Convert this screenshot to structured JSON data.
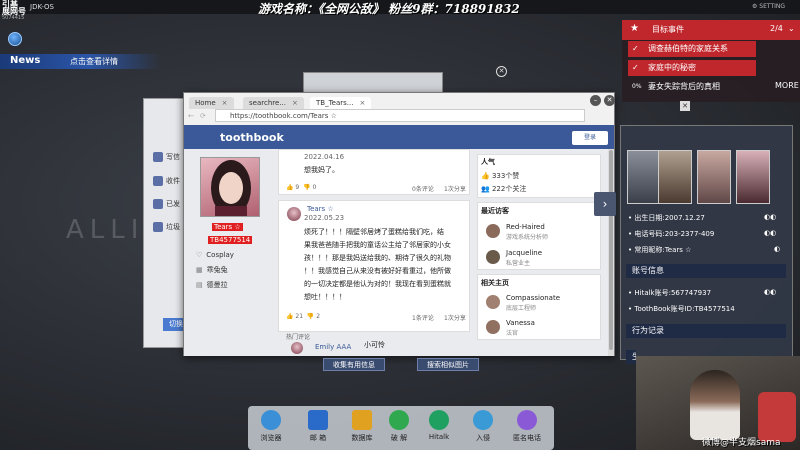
{
  "topbar": {
    "logo": "引基\n展网号",
    "os_name": "JDK-OS",
    "sub": "5074415",
    "title": "游戏名称：《全网公敌》 粉丝9群：718891832",
    "setting": "SETTING"
  },
  "news": {
    "label": "News",
    "link": "点击查看详情"
  },
  "ghost": "ALLI",
  "back_window": {
    "items": [
      "写信",
      "收件",
      "已发",
      "垃圾"
    ],
    "button": "切换"
  },
  "browser": {
    "tabs": [
      {
        "label": "Home"
      },
      {
        "label": "searchre..."
      },
      {
        "label": "TB_Tears..."
      }
    ],
    "url": "https://toothbook.com/Tears ☆",
    "brand": "toothbook",
    "login": "登录",
    "profile": {
      "name": "Tears ☆",
      "id": "TB4577514",
      "info": [
        "Cosplay",
        "乖兔兔",
        "德曼拉"
      ]
    },
    "posts": [
      {
        "date": "2022.04.16",
        "text": "想我妈了。",
        "likes": "9",
        "dislikes": "0",
        "comments": "0条评论",
        "shares": "1次分享"
      },
      {
        "name": "Tears ☆",
        "date": "2022.05.23",
        "text": [
          "烦死了！！！隔壁邻居烤了蛋糕给我们吃，结",
          "果我爸爸随手把我的童话公主给了邻居家的小女",
          "孩！！！那是我妈送给我的、期待了很久的礼物",
          "！！我感觉自己从来没有被好好看重过，他所做",
          "的一切决定都是他认为对的！我现在看到蛋糕就",
          "想吐！！！！"
        ],
        "likes": "21",
        "dislikes": "2",
        "comments": "1条评论",
        "shares": "1次分享"
      }
    ],
    "hot_comment_label": "热门评论",
    "hot_comment": {
      "name": "Emily AAA",
      "text": "小可怜"
    },
    "popularity": {
      "title": "人气",
      "likes": "333个赞",
      "followers": "222个关注"
    },
    "visitors": {
      "title": "最近访客",
      "people": [
        {
          "name": "Red-Haired",
          "role": "游戏系统分析师"
        },
        {
          "name": "Jacqueline",
          "role": "私营业主"
        }
      ]
    },
    "related": {
      "title": "相关主页",
      "people": [
        {
          "name": "Compassionate",
          "role": "底层工程师"
        },
        {
          "name": "Vanessa",
          "role": "法官"
        }
      ]
    }
  },
  "bottom_buttons": [
    "收集有用信息",
    "搜索相似图片"
  ],
  "dock": [
    "浏览器",
    "邮 箱",
    "数据库",
    "破 解",
    "Hitalk",
    "入侵",
    "匿名电话"
  ],
  "tasks": {
    "title": "目标事件",
    "count": "2/4",
    "items": [
      "调查赫伯特的家庭关系",
      "家庭中的秘密",
      "妻女失踪背后的真相"
    ],
    "percent": "0%",
    "more": "MORE"
  },
  "info_panel": {
    "rows": [
      "出生日期:2007.12.27",
      "电话号码:203-2377-409",
      "常用昵称:Tears ☆"
    ],
    "account_title": "账号信息",
    "accounts": [
      "Hitalk账号:567747937",
      "ToothBook账号ID:TB4577514"
    ],
    "action_title": "行为记录",
    "cut_title": "生活轨迹"
  },
  "webcam": {
    "caption": "微博@半支烟sama"
  },
  "colors": {
    "accent_red": "#c0272d",
    "brand_blue": "#3b5998"
  }
}
